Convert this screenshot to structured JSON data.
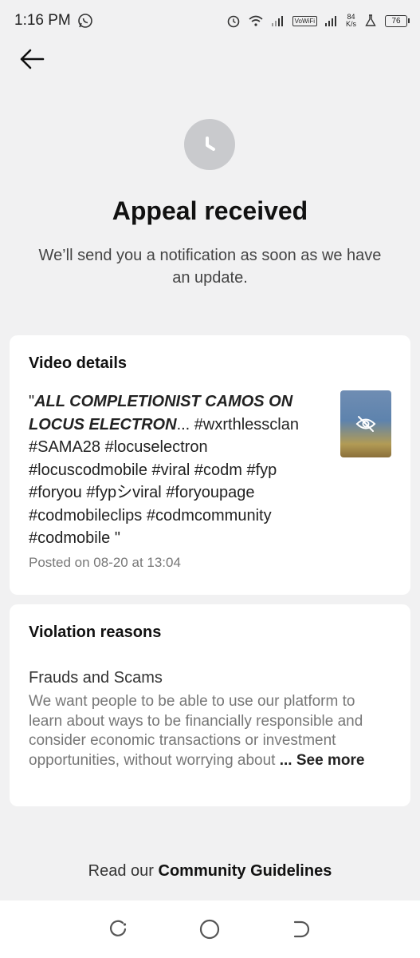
{
  "status_bar": {
    "time": "1:16 PM",
    "net_speed_value": "84",
    "net_speed_unit": "K/s",
    "vowifi": "VoWiFi",
    "battery": "76"
  },
  "header": {
    "title": "Appeal received",
    "subtitle": "We’ll send you a notification as soon as we have an update."
  },
  "video_details": {
    "heading": "Video details",
    "quote_open": "\"",
    "title_bold": "ALL COMPLETIONIST CAMOS ON LOCUS ELECTRON",
    "ellipsis": "...",
    "hashtags": "#wxrthlessclan #SAMA28 #locuselectron #locuscodmobile #viral #codm #fyp #foryou #fypシviral #foryoupage #codmobileclips #codmcommunity #codmobile \"",
    "posted": "Posted on 08-20 at 13:04"
  },
  "violation": {
    "heading": "Violation reasons",
    "reason": "Frauds and Scams",
    "description": "We want people to be able to use our platform to learn about ways to be financially responsible and consider economic transactions or investment opportunities, without worrying about",
    "see_more": "... See more"
  },
  "footer": {
    "prefix": "Read our ",
    "link": "Community Guidelines"
  },
  "icons": {
    "back": "arrow-left-icon",
    "status": "clock-icon",
    "thumbnail": "eye-off-icon"
  },
  "colors": {
    "background": "#f1f1f2",
    "card": "#ffffff",
    "clock_circle": "#c9cacd"
  }
}
